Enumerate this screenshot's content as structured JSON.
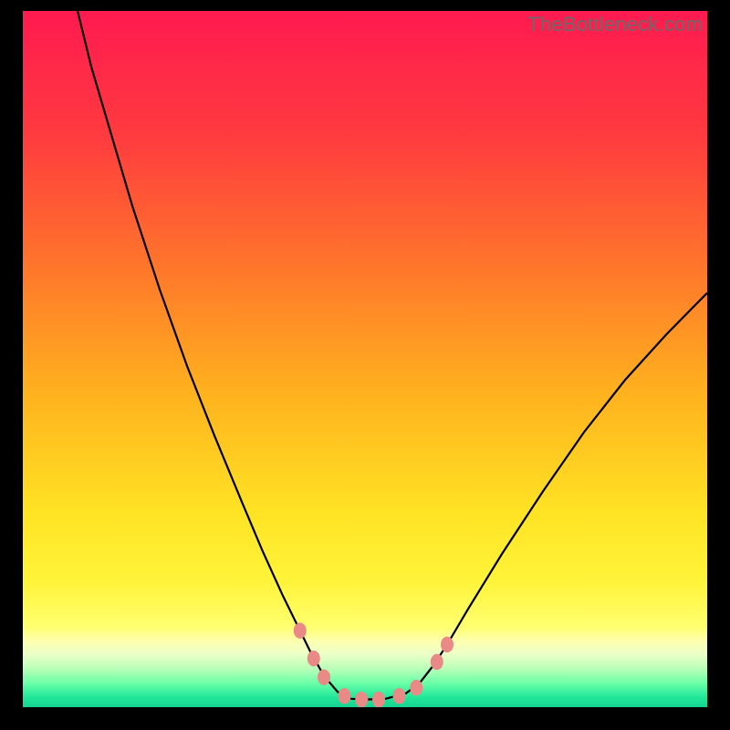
{
  "watermark": "TheBottleneck.com",
  "chart_data": {
    "type": "line",
    "title": "",
    "xlabel": "",
    "ylabel": "",
    "xlim": [
      0,
      100
    ],
    "ylim": [
      0,
      100
    ],
    "grid": false,
    "legend": false,
    "background_gradient": {
      "stops": [
        {
          "offset": 0.0,
          "color": "#ff1a50"
        },
        {
          "offset": 0.18,
          "color": "#ff3b3f"
        },
        {
          "offset": 0.38,
          "color": "#ff7a2a"
        },
        {
          "offset": 0.55,
          "color": "#ffb21e"
        },
        {
          "offset": 0.72,
          "color": "#ffe324"
        },
        {
          "offset": 0.82,
          "color": "#fff43a"
        },
        {
          "offset": 0.885,
          "color": "#ffff70"
        },
        {
          "offset": 0.905,
          "color": "#fdffb0"
        },
        {
          "offset": 0.925,
          "color": "#eaffc8"
        },
        {
          "offset": 0.945,
          "color": "#b8ffb8"
        },
        {
          "offset": 0.965,
          "color": "#6dffa8"
        },
        {
          "offset": 0.985,
          "color": "#22e89a"
        },
        {
          "offset": 1.0,
          "color": "#14d490"
        }
      ]
    },
    "series": [
      {
        "name": "bottleneck-curve",
        "stroke": "#000000",
        "stroke_width": 2.2,
        "points": [
          {
            "x": 8.0,
            "y": 100.0
          },
          {
            "x": 10.0,
            "y": 92.0
          },
          {
            "x": 13.0,
            "y": 82.0
          },
          {
            "x": 16.0,
            "y": 72.0
          },
          {
            "x": 20.0,
            "y": 60.0
          },
          {
            "x": 24.0,
            "y": 49.0
          },
          {
            "x": 28.0,
            "y": 39.0
          },
          {
            "x": 32.0,
            "y": 29.5
          },
          {
            "x": 35.0,
            "y": 22.5
          },
          {
            "x": 38.0,
            "y": 16.0
          },
          {
            "x": 40.0,
            "y": 12.0
          },
          {
            "x": 42.0,
            "y": 8.0
          },
          {
            "x": 44.0,
            "y": 4.5
          },
          {
            "x": 46.0,
            "y": 2.2
          },
          {
            "x": 48.0,
            "y": 1.2
          },
          {
            "x": 50.0,
            "y": 1.1
          },
          {
            "x": 53.0,
            "y": 1.2
          },
          {
            "x": 56.0,
            "y": 2.0
          },
          {
            "x": 58.0,
            "y": 3.5
          },
          {
            "x": 60.0,
            "y": 6.0
          },
          {
            "x": 62.0,
            "y": 9.0
          },
          {
            "x": 65.0,
            "y": 14.0
          },
          {
            "x": 70.0,
            "y": 22.0
          },
          {
            "x": 76.0,
            "y": 31.0
          },
          {
            "x": 82.0,
            "y": 39.5
          },
          {
            "x": 88.0,
            "y": 47.0
          },
          {
            "x": 94.0,
            "y": 53.5
          },
          {
            "x": 100.0,
            "y": 59.5
          }
        ]
      }
    ],
    "markers": {
      "fill": "#ea8a86",
      "radius": 7,
      "points": [
        {
          "x": 40.5,
          "y": 11.0
        },
        {
          "x": 42.5,
          "y": 7.0
        },
        {
          "x": 44.0,
          "y": 4.3
        },
        {
          "x": 47.0,
          "y": 1.6
        },
        {
          "x": 49.5,
          "y": 1.1
        },
        {
          "x": 52.0,
          "y": 1.1
        },
        {
          "x": 55.0,
          "y": 1.6
        },
        {
          "x": 57.5,
          "y": 2.8
        },
        {
          "x": 60.5,
          "y": 6.5
        },
        {
          "x": 62.0,
          "y": 9.0
        }
      ]
    }
  }
}
